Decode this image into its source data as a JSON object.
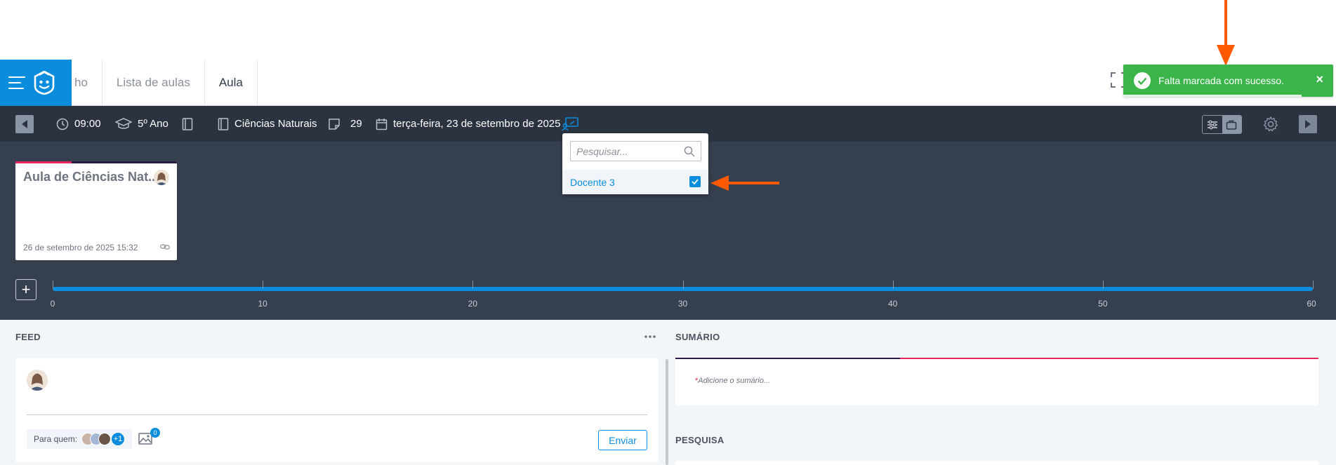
{
  "header": {
    "tabs": [
      {
        "label": "ho"
      },
      {
        "label": "Lista de aulas"
      },
      {
        "label": "Aula"
      }
    ]
  },
  "toolbar": {
    "time": "09:00",
    "grade": "5º Ano",
    "subject": "Ciências Naturais",
    "count": "29",
    "date": "terça-feira, 23 de setembro de 2025"
  },
  "dropdown": {
    "search_placeholder": "Pesquisar...",
    "options": [
      {
        "label": "Docente 3",
        "checked": true
      }
    ]
  },
  "toast": {
    "message": "Falta marcada com sucesso.",
    "close": "×"
  },
  "lesson_card": {
    "title": "Aula de Ciências Nat...",
    "date": "26 de setembro de 2025 15:32"
  },
  "timeline": {
    "add": "+",
    "ticks": [
      "0",
      "10",
      "20",
      "30",
      "40",
      "50",
      "60"
    ]
  },
  "feed": {
    "title": "FEED",
    "recipients_label": "Para quem:",
    "extra_count": "+1",
    "image_count": "0",
    "send_label": "Enviar"
  },
  "summary": {
    "title": "SUMÁRIO",
    "required_mark": "*",
    "placeholder": "Adicione o sumário..."
  },
  "survey": {
    "title": "PESQUISA"
  },
  "colors": {
    "primary": "#0a8ddc",
    "toolbar": "#2b3340",
    "timeline": "#363f4e",
    "success": "#3bb54a",
    "accent_pink": "#e8245f",
    "arrow": "#ff5a00"
  }
}
